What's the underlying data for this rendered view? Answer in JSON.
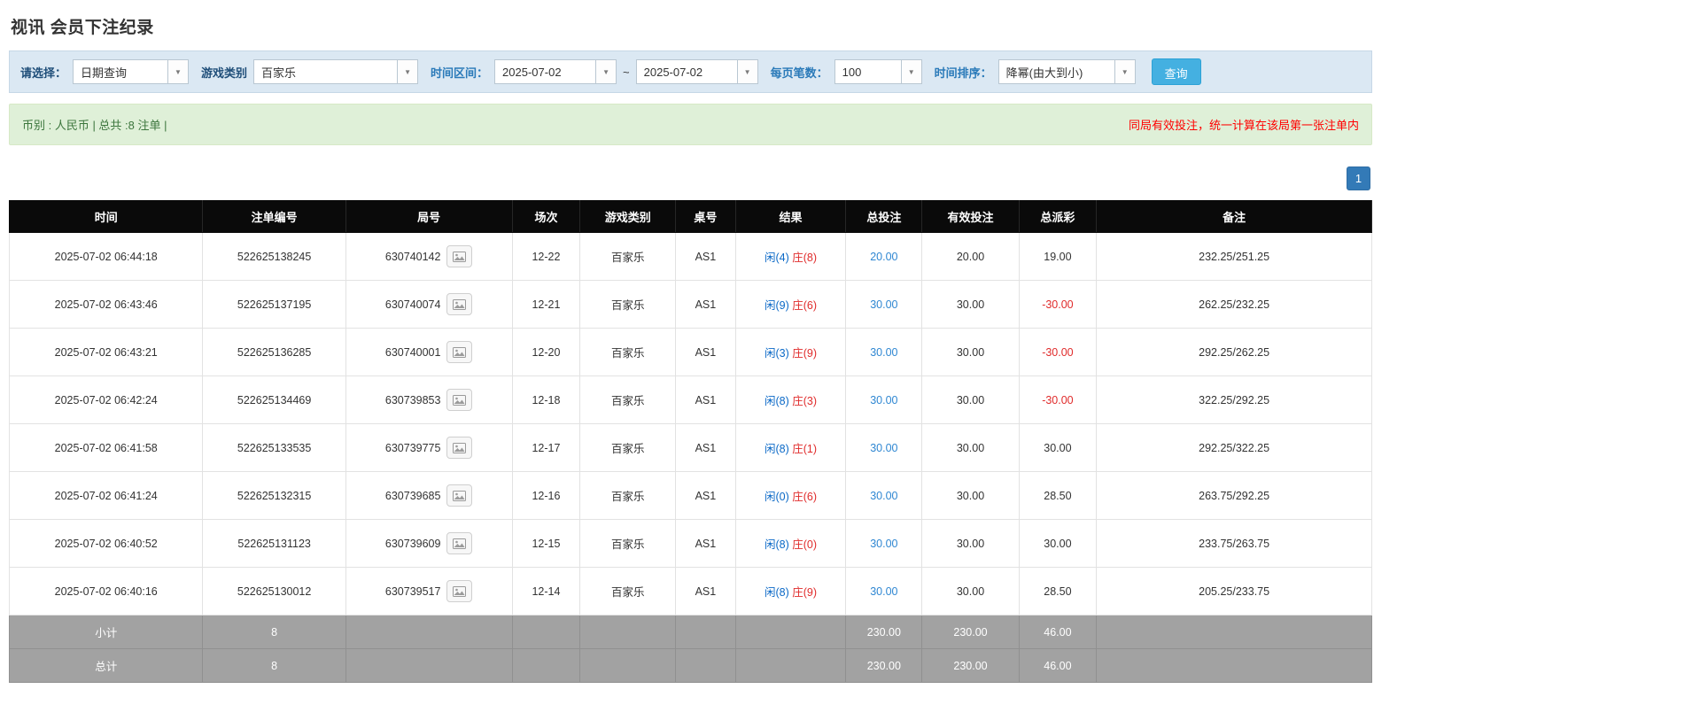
{
  "page": {
    "title": "视讯 会员下注纪录"
  },
  "filters": {
    "select_label": "请选择：",
    "select_value": "日期查询",
    "game_type_label": "游戏类别",
    "game_type_value": "百家乐",
    "date_range_label": "时间区间：",
    "date_from": "2025-07-02",
    "date_separator": "~",
    "date_to": "2025-07-02",
    "page_size_label": "每页笔数：",
    "page_size_value": "100",
    "sort_label": "时间排序：",
    "sort_value": "降幂(由大到小)",
    "search_button": "查询",
    "accent_color": "#44b0e1"
  },
  "summary": {
    "left_text": "币别 : 人民币 | 总共 :8 注单 |",
    "right_note": "同局有效投注，统一计算在该局第一张注单内",
    "note_color": "#ff0000"
  },
  "pagination": {
    "current_page": "1"
  },
  "table": {
    "headers": [
      "时间",
      "注单编号",
      "局号",
      "场次",
      "游戏类别",
      "桌号",
      "结果",
      "总投注",
      "有效投注",
      "总派彩",
      "备注"
    ],
    "rows": [
      {
        "time": "2025-07-02 06:44:18",
        "bet_id": "522625138245",
        "round_id": "630740142",
        "session": "12-22",
        "game": "百家乐",
        "table_no": "AS1",
        "result_player": "闲(4)",
        "result_banker": "庄(8)",
        "total_bet": "20.00",
        "valid_bet": "20.00",
        "payout": "19.00",
        "note": "232.25/251.25"
      },
      {
        "time": "2025-07-02 06:43:46",
        "bet_id": "522625137195",
        "round_id": "630740074",
        "session": "12-21",
        "game": "百家乐",
        "table_no": "AS1",
        "result_player": "闲(9)",
        "result_banker": "庄(6)",
        "total_bet": "30.00",
        "valid_bet": "30.00",
        "payout": "-30.00",
        "note": "262.25/232.25"
      },
      {
        "time": "2025-07-02 06:43:21",
        "bet_id": "522625136285",
        "round_id": "630740001",
        "session": "12-20",
        "game": "百家乐",
        "table_no": "AS1",
        "result_player": "闲(3)",
        "result_banker": "庄(9)",
        "total_bet": "30.00",
        "valid_bet": "30.00",
        "payout": "-30.00",
        "note": "292.25/262.25"
      },
      {
        "time": "2025-07-02 06:42:24",
        "bet_id": "522625134469",
        "round_id": "630739853",
        "session": "12-18",
        "game": "百家乐",
        "table_no": "AS1",
        "result_player": "闲(8)",
        "result_banker": "庄(3)",
        "total_bet": "30.00",
        "valid_bet": "30.00",
        "payout": "-30.00",
        "note": "322.25/292.25"
      },
      {
        "time": "2025-07-02 06:41:58",
        "bet_id": "522625133535",
        "round_id": "630739775",
        "session": "12-17",
        "game": "百家乐",
        "table_no": "AS1",
        "result_player": "闲(8)",
        "result_banker": "庄(1)",
        "total_bet": "30.00",
        "valid_bet": "30.00",
        "payout": "30.00",
        "note": "292.25/322.25"
      },
      {
        "time": "2025-07-02 06:41:24",
        "bet_id": "522625132315",
        "round_id": "630739685",
        "session": "12-16",
        "game": "百家乐",
        "table_no": "AS1",
        "result_player": "闲(0)",
        "result_banker": "庄(6)",
        "total_bet": "30.00",
        "valid_bet": "30.00",
        "payout": "28.50",
        "note": "263.75/292.25"
      },
      {
        "time": "2025-07-02 06:40:52",
        "bet_id": "522625131123",
        "round_id": "630739609",
        "session": "12-15",
        "game": "百家乐",
        "table_no": "AS1",
        "result_player": "闲(8)",
        "result_banker": "庄(0)",
        "total_bet": "30.00",
        "valid_bet": "30.00",
        "payout": "30.00",
        "note": "233.75/263.75"
      },
      {
        "time": "2025-07-02 06:40:16",
        "bet_id": "522625130012",
        "round_id": "630739517",
        "session": "12-14",
        "game": "百家乐",
        "table_no": "AS1",
        "result_player": "闲(8)",
        "result_banker": "庄(9)",
        "total_bet": "30.00",
        "valid_bet": "30.00",
        "payout": "28.50",
        "note": "205.25/233.75"
      }
    ],
    "subtotal": {
      "label": "小计",
      "count": "8",
      "total_bet": "230.00",
      "valid_bet": "230.00",
      "payout": "46.00"
    },
    "total": {
      "label": "总计",
      "count": "8",
      "total_bet": "230.00",
      "valid_bet": "230.00",
      "payout": "46.00"
    },
    "result_colors": {
      "player": "#0b69c7",
      "banker": "#e02b2b"
    }
  }
}
